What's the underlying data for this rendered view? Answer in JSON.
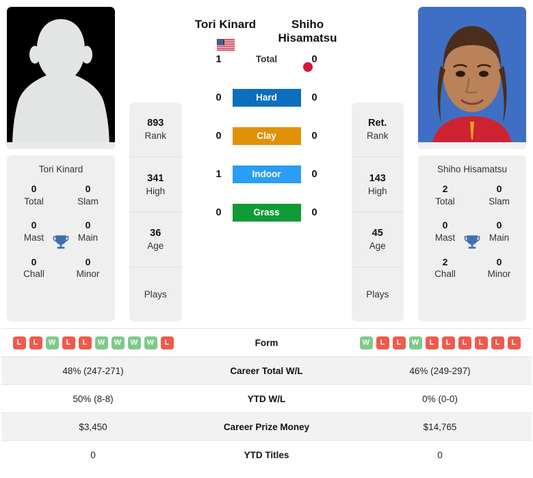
{
  "players": {
    "left": {
      "name": "Tori Kinard",
      "flag": "us-flag-icon",
      "photo": "silhouette-placeholder-photo",
      "card_name": "Tori Kinard",
      "titles": [
        {
          "value": "0",
          "label": "Total"
        },
        {
          "value": "0",
          "label": "Slam"
        },
        {
          "value": "0",
          "label": "Mast"
        },
        {
          "value": "0",
          "label": "Main"
        },
        {
          "value": "0",
          "label": "Chall"
        },
        {
          "value": "0",
          "label": "Minor"
        }
      ],
      "ranks": [
        {
          "value": "893",
          "label": "Rank"
        },
        {
          "value": "341",
          "label": "High"
        },
        {
          "value": "36",
          "label": "Age"
        },
        {
          "value": "",
          "label": "Plays"
        }
      ],
      "form": [
        "L",
        "L",
        "W",
        "L",
        "L",
        "W",
        "W",
        "W",
        "W",
        "L"
      ]
    },
    "right": {
      "name": "Shiho Hisamatsu",
      "flag": "jp-flag-icon",
      "photo": "player-portrait-photo",
      "card_name": "Shiho Hisamatsu",
      "titles": [
        {
          "value": "2",
          "label": "Total"
        },
        {
          "value": "0",
          "label": "Slam"
        },
        {
          "value": "0",
          "label": "Mast"
        },
        {
          "value": "0",
          "label": "Main"
        },
        {
          "value": "2",
          "label": "Chall"
        },
        {
          "value": "0",
          "label": "Minor"
        }
      ],
      "ranks": [
        {
          "value": "Ret.",
          "label": "Rank"
        },
        {
          "value": "143",
          "label": "High"
        },
        {
          "value": "45",
          "label": "Age"
        },
        {
          "value": "",
          "label": "Plays"
        }
      ],
      "form": [
        "W",
        "L",
        "L",
        "W",
        "L",
        "L",
        "L",
        "L",
        "L",
        "L"
      ]
    }
  },
  "surfaces": [
    {
      "label": "Total",
      "left": "1",
      "right": "0",
      "color": "transparent"
    },
    {
      "label": "Hard",
      "left": "0",
      "right": "0",
      "color": "#0b6fbd"
    },
    {
      "label": "Clay",
      "left": "0",
      "right": "0",
      "color": "#e09106"
    },
    {
      "label": "Indoor",
      "left": "1",
      "right": "0",
      "color": "#2a9df4"
    },
    {
      "label": "Grass",
      "left": "0",
      "right": "0",
      "color": "#0f9b35"
    }
  ],
  "table": {
    "form_label": "Form",
    "rows": [
      {
        "label": "Career Total W/L",
        "left": "48% (247-271)",
        "right": "46% (249-297)"
      },
      {
        "label": "YTD W/L",
        "left": "50% (8-8)",
        "right": "0% (0-0)"
      },
      {
        "label": "Career Prize Money",
        "left": "$3,450",
        "right": "$14,765"
      },
      {
        "label": "YTD Titles",
        "left": "0",
        "right": "0"
      }
    ]
  },
  "colors": {
    "win": "#7fc98a",
    "loss": "#ef5a4c",
    "panel": "#efefef",
    "trophy": "#3f6fae"
  }
}
